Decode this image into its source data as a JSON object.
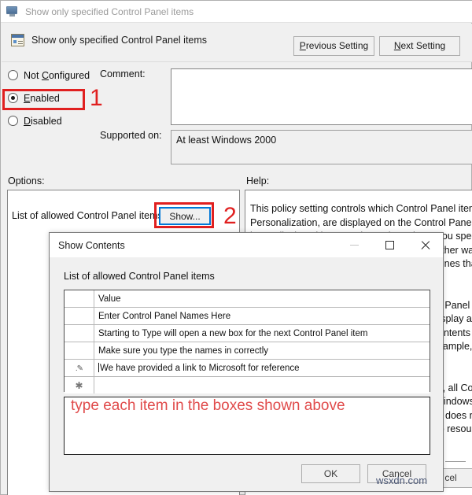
{
  "window": {
    "titlebar_text": "Show only specified Control Panel items",
    "titlebar_icon": "monitor-icon",
    "header_title": "Show only specified Control Panel items",
    "header_icon": "policy-setting-icon",
    "previous_setting_label": "Previous Setting",
    "next_setting_label": "Next Setting"
  },
  "state": {
    "not_configured_label": "Not Configured",
    "enabled_label": "Enabled",
    "disabled_label": "Disabled",
    "selected": "Enabled"
  },
  "fields": {
    "comment_label": "Comment:",
    "comment_value": "",
    "supported_label": "Supported on:",
    "supported_value": "At least Windows 2000"
  },
  "panes": {
    "options_label": "Options:",
    "help_label": "Help:",
    "option_row_label": "List of allowed Control Panel items",
    "show_button_label": "Show...",
    "help_text": "This policy setting controls which Control Panel items such as Mouse, System, or Personalization, are displayed on the Control Panel window and the Start screen. The only items displayed in Control Panel are those you specify in this setting. This setting affects the Start screen and Control Panel, as well as other ways to access Control Panel items such as shortcuts in Help and Support or command lines that use control.exe. This policy setting has no effect on items displayed in PC settings.\n\nIf you enable this policy setting, only Control Panel items that you specify are displayed in Control Panel and on the Start screen. To display a Control Panel item, enable the policy setting, click Show, and then in the Show Contents dialog box in the Value column, enter the Control Panel item's canonical name. For example, enter Microsoft.Mouse, Microsoft.System, or Microsoft.Personalization.\n\nIf you disable or do not configure this setting, all Control Panel items are displayed, and each Control Panel item is displayed. Note: For Windows Vista, Windows Server 2008, and earlier versions of Windows, if a Control Panel item does not have a canonical name specified, it might be hidden. If this occurs, it contains no resource identifier."
  },
  "dialog": {
    "title": "Show Contents",
    "minimize_icon": "minimize-icon",
    "maximize_icon": "maximize-icon",
    "close_icon": "close-icon",
    "subtitle": "List of allowed Control Panel items",
    "grid": {
      "columns": [
        "",
        "Value"
      ],
      "rows": [
        {
          "marker": "",
          "value": "Enter Control Panel Names Here"
        },
        {
          "marker": "",
          "value": "Starting to Type will open a new box for the next Control Panel item"
        },
        {
          "marker": "",
          "value": "Make sure you type the names in correctly"
        },
        {
          "marker": "edit",
          "value": "We have provided a link to Microsoft for reference"
        },
        {
          "marker": "new",
          "value": ""
        }
      ]
    },
    "ok_label": "OK",
    "cancel_label": "Cancel"
  },
  "annotations": {
    "step_one": "1",
    "step_two": "2",
    "note_text": "type each item in the boxes shown above",
    "note_color": "#e04a4a",
    "box_color": "#e02020",
    "focus_color": "#0078d7"
  },
  "parent_footer": {
    "cancel_label": "cel"
  },
  "watermark": "wsxdn.com"
}
